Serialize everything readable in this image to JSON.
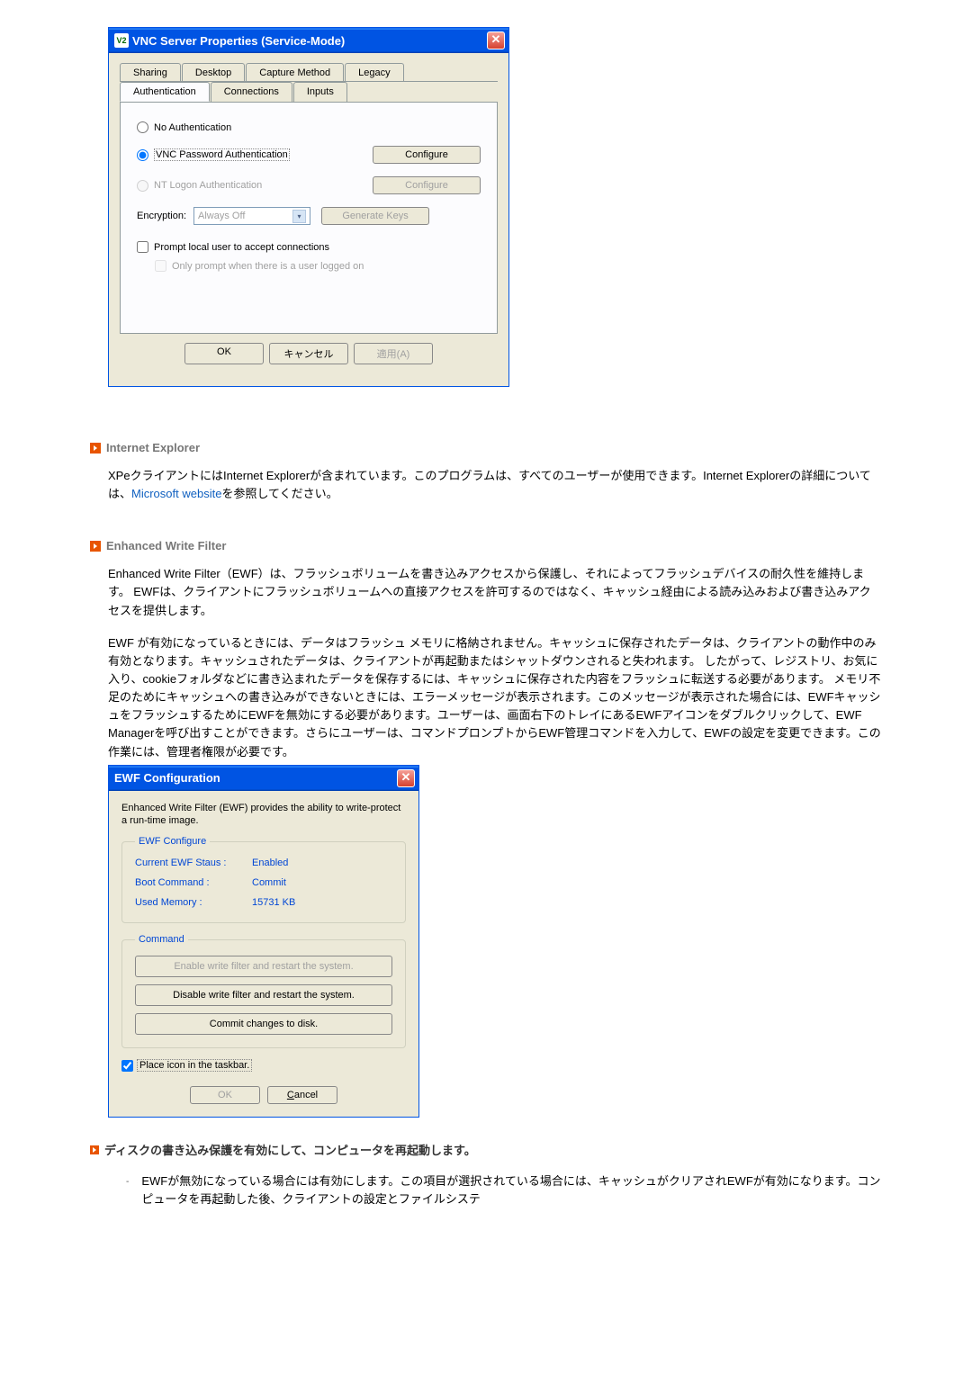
{
  "vnc": {
    "title": "VNC Server Properties (Service-Mode)",
    "tabs_row1": [
      "Sharing",
      "Desktop",
      "Capture Method",
      "Legacy"
    ],
    "tabs_row2": [
      "Authentication",
      "Connections",
      "Inputs"
    ],
    "no_auth": "No Authentication",
    "vnc_pwd_auth": "VNC Password Authentication",
    "nt_logon": "NT Logon Authentication",
    "configure": "Configure",
    "encryption_label": "Encryption:",
    "encryption_value": "Always Off",
    "generate_keys": "Generate Keys",
    "prompt_local": "Prompt local user to accept connections",
    "only_prompt": "Only prompt when there is a user logged on",
    "ok": "OK",
    "cancel": "キャンセル",
    "apply": "適用(A)"
  },
  "ie": {
    "heading": "Internet Explorer",
    "body_pre": "XPeクライアントにはInternet Explorerが含まれています。このプログラムは、すべてのユーザーが使用できます。Internet Explorerの詳細については、",
    "link": "Microsoft website",
    "body_post": "を参照してください。"
  },
  "ewf_section": {
    "heading": "Enhanced Write Filter",
    "p1": "Enhanced Write Filter（EWF）は、フラッシュボリュームを書き込みアクセスから保護し、それによってフラッシュデバイスの耐久性を維持します。 EWFは、クライアントにフラッシュボリュームへの直接アクセスを許可するのではなく、キャッシュ経由による読み込みおよび書き込みアクセスを提供します。",
    "p2": "EWF が有効になっているときには、データはフラッシュ メモリに格納されません。キャッシュに保存されたデータは、クライアントの動作中のみ有効となります。キャッシュされたデータは、クライアントが再起動またはシャットダウンされると失われます。 したがって、レジストリ、お気に入り、cookieフォルダなどに書き込まれたデータを保存するには、キャッシュに保存された内容をフラッシュに転送する必要があります。 メモリ不足のためにキャッシュへの書き込みができないときには、エラーメッセージが表示されます。このメッセージが表示された場合には、EWFキャッシュをフラッシュするためにEWFを無効にする必要があります。ユーザーは、画面右下のトレイにあるEWFアイコンをダブルクリックして、EWF Managerを呼び出すことができます。さらにユーザーは、コマンドプロンプトからEWF管理コマンドを入力して、EWFの設定を変更できます。この作業には、管理者権限が必要です。"
  },
  "ewf_dialog": {
    "title": "EWF Configuration",
    "intro": "Enhanced Write Filter (EWF) provides the ability to write-protect a run-time image.",
    "group_config": "EWF Configure",
    "status_k": "Current EWF Staus :",
    "status_v": "Enabled",
    "boot_k": "Boot Command :",
    "boot_v": "Commit",
    "mem_k": "Used Memory :",
    "mem_v": "15731 KB",
    "group_cmd": "Command",
    "btn_enable": "Enable write filter and restart the system.",
    "btn_disable": "Disable write filter and restart the system.",
    "btn_commit": "Commit changes to disk.",
    "chk_taskbar": "Place icon in the taskbar.",
    "ok": "OK",
    "cancel": "Cancel"
  },
  "sublist": {
    "heading": "ディスクの書き込み保護を有効にして、コンピュータを再起動します。",
    "item1": "EWFが無効になっている場合には有効にします。この項目が選択されている場合には、キャッシュがクリアされEWFが有効になります。コンピュータを再起動した後、クライアントの設定とファイルシステ"
  }
}
